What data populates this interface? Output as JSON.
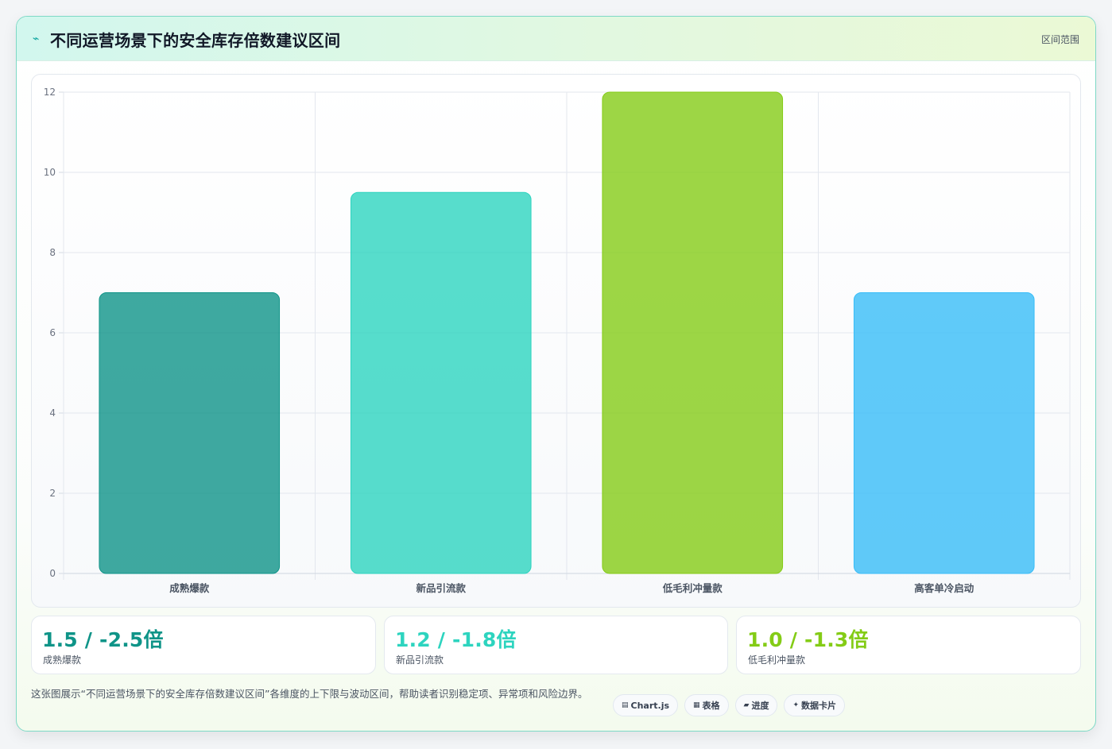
{
  "header": {
    "title": "不同运营场景下的安全库存倍数建议区间",
    "range_label": "区间范围",
    "logo_icon": "spark-icon"
  },
  "chart_data": {
    "type": "bar",
    "title": "",
    "xlabel": "",
    "ylabel": "",
    "categories": [
      "成熟爆款",
      "新品引流款",
      "低毛利冲量款",
      "高客单冷启动"
    ],
    "values": [
      7,
      9.5,
      12,
      7
    ],
    "colors": [
      "#0f9488",
      "#2dd4bf",
      "#84cc16",
      "#38bdf8"
    ],
    "ylim": [
      0,
      12
    ],
    "yticks": [
      "0",
      "2",
      "4",
      "6",
      "8",
      "10",
      "12"
    ],
    "grid": true
  },
  "stats": [
    {
      "value": "1.5 / -2.5倍",
      "label": "成熟爆款",
      "color": "#0f9488"
    },
    {
      "value": "1.2 / -1.8倍",
      "label": "新品引流款",
      "color": "#2dd4bf"
    },
    {
      "value": "1.0 / -1.3倍",
      "label": "低毛利冲量款",
      "color": "#84cc16"
    }
  ],
  "footer": {
    "description": "这张图展示“不同运营场景下的安全库存倍数建议区间”各维度的上下限与波动区间，帮助读者识别稳定项、异常项和风险边界。",
    "chips": [
      {
        "icon": "▤",
        "label": "Chart.js"
      },
      {
        "icon": "▦",
        "label": "表格"
      },
      {
        "icon": "▰",
        "label": "进度"
      },
      {
        "icon": "✦",
        "label": "数据卡片"
      }
    ]
  }
}
